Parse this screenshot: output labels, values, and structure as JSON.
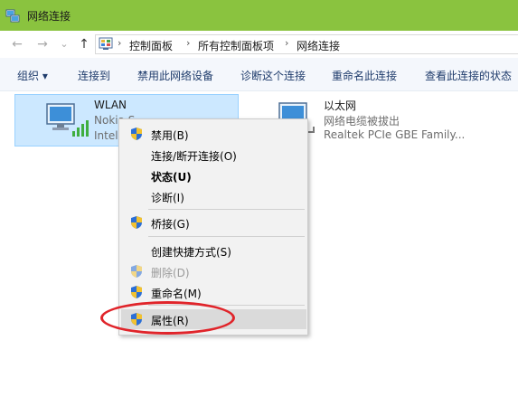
{
  "window": {
    "title": "网络连接"
  },
  "nav": {
    "back_glyph": "←",
    "forward_glyph": "→",
    "dropdown_glyph": "⌄",
    "up_glyph": "↑"
  },
  "address": {
    "crumbs": [
      "控制面板",
      "所有控制面板项",
      "网络连接"
    ],
    "separator": "›"
  },
  "toolbar": {
    "items": [
      "组织 ▾",
      "连接到",
      "禁用此网络设备",
      "诊断这个连接",
      "重命名此连接",
      "查看此连接的状态"
    ]
  },
  "connections": [
    {
      "name": "WLAN",
      "line2": "Nokia S",
      "line3": "Intel",
      "icon": "wifi-adapter-icon",
      "selected": true
    },
    {
      "name": "以太网",
      "line2": "网络电缆被拔出",
      "line3": "Realtek PCIe GBE Family...",
      "icon": "ethernet-adapter-icon",
      "selected": false
    }
  ],
  "context_menu": {
    "items": [
      {
        "label": "禁用(B)",
        "shield": true
      },
      {
        "label": "连接/断开连接(O)",
        "shield": false
      },
      {
        "label": "状态(U)",
        "shield": false,
        "bold": true
      },
      {
        "label": "诊断(I)",
        "shield": false
      },
      {
        "label": "桥接(G)",
        "shield": true
      },
      {
        "label": "创建快捷方式(S)",
        "shield": false
      },
      {
        "label": "删除(D)",
        "shield": true,
        "disabled": true
      },
      {
        "label": "重命名(M)",
        "shield": true
      },
      {
        "label": "属性(R)",
        "shield": true,
        "highlighted": true
      }
    ]
  },
  "colors": {
    "titlebar": "#8ac33f",
    "selection": "#cce8ff",
    "annotation_circle": "#e0242a"
  }
}
